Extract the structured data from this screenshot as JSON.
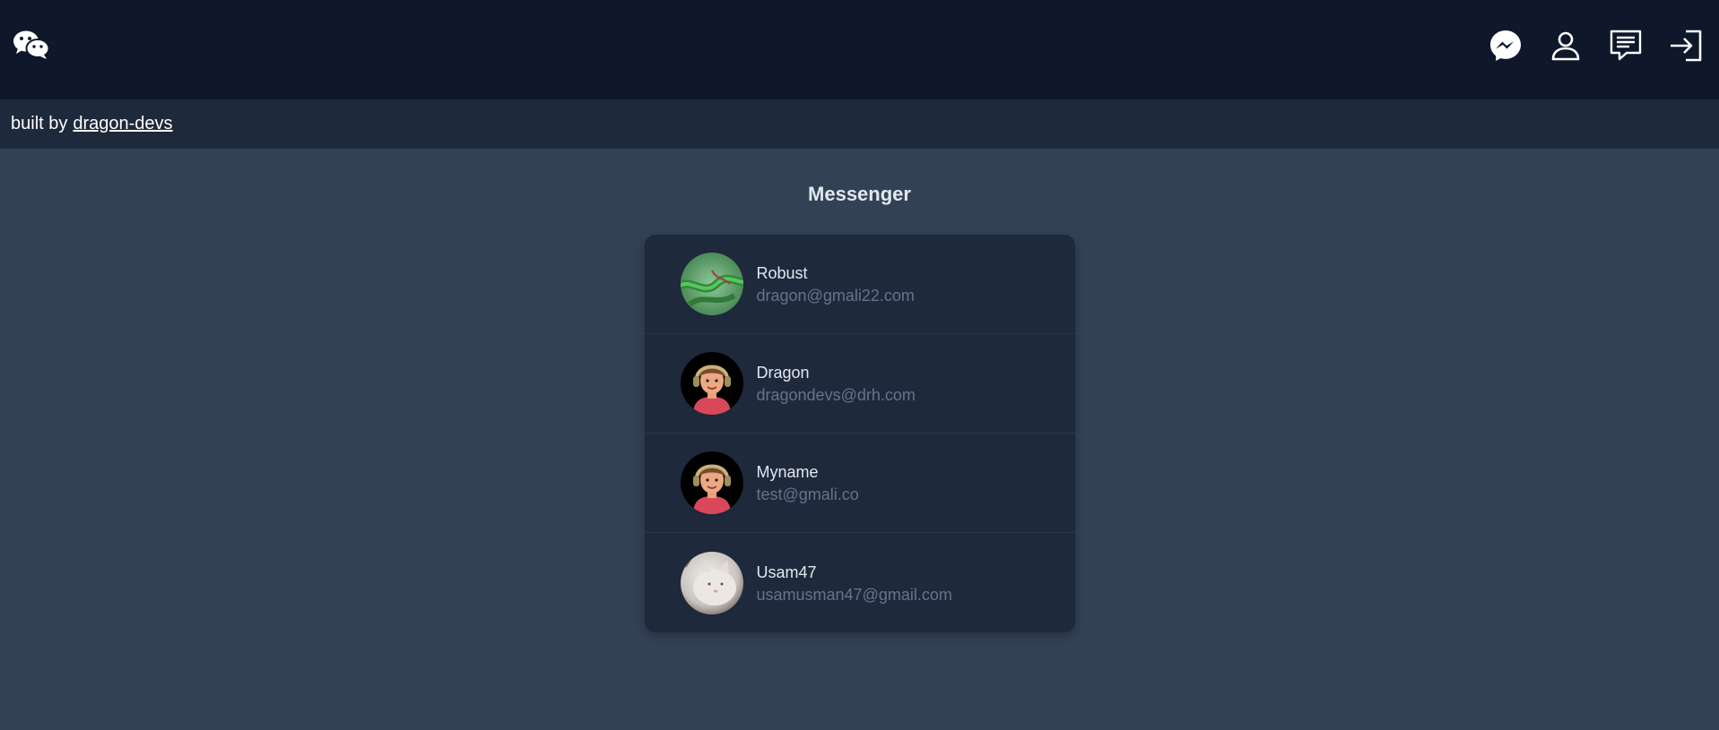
{
  "navbar": {
    "logo_icon": "wechat-logo-icon",
    "actions": [
      {
        "name": "messenger-button",
        "icon": "messenger-icon"
      },
      {
        "name": "profile-button",
        "icon": "user-icon"
      },
      {
        "name": "chat-button",
        "icon": "message-square-icon"
      },
      {
        "name": "login-button",
        "icon": "sign-in-icon"
      }
    ]
  },
  "subbar": {
    "prefix": "built by",
    "link_text": "dragon-devs"
  },
  "page": {
    "title": "Messenger"
  },
  "contacts": [
    {
      "name": "Robust",
      "email": "dragon@gmali22.com",
      "avatar": "green-snake-photo"
    },
    {
      "name": "Dragon",
      "email": "dragondevs@drh.com",
      "avatar": "cartoon-boy-headphones"
    },
    {
      "name": "Myname",
      "email": "test@gmali.co",
      "avatar": "cartoon-boy-headphones"
    },
    {
      "name": "Usam47",
      "email": "usamusman47@gmail.com",
      "avatar": "white-cat-photo"
    }
  ],
  "colors": {
    "navbar_bg": "#0f172a",
    "subbar_bg": "#1e293b",
    "page_bg": "#334155",
    "card_bg": "#1e293b",
    "email_text": "#64748b"
  }
}
